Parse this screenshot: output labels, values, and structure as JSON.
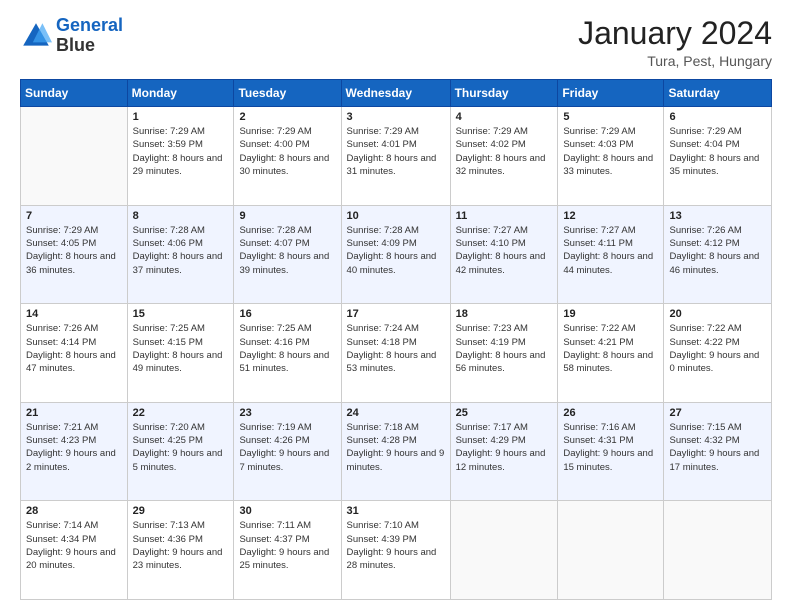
{
  "header": {
    "logo_line1": "General",
    "logo_line2": "Blue",
    "title": "January 2024",
    "subtitle": "Tura, Pest, Hungary"
  },
  "weekdays": [
    "Sunday",
    "Monday",
    "Tuesday",
    "Wednesday",
    "Thursday",
    "Friday",
    "Saturday"
  ],
  "weeks": [
    [
      {
        "day": "",
        "sunrise": "",
        "sunset": "",
        "daylight": ""
      },
      {
        "day": "1",
        "sunrise": "7:29 AM",
        "sunset": "3:59 PM",
        "daylight": "8 hours and 29 minutes."
      },
      {
        "day": "2",
        "sunrise": "7:29 AM",
        "sunset": "4:00 PM",
        "daylight": "8 hours and 30 minutes."
      },
      {
        "day": "3",
        "sunrise": "7:29 AM",
        "sunset": "4:01 PM",
        "daylight": "8 hours and 31 minutes."
      },
      {
        "day": "4",
        "sunrise": "7:29 AM",
        "sunset": "4:02 PM",
        "daylight": "8 hours and 32 minutes."
      },
      {
        "day": "5",
        "sunrise": "7:29 AM",
        "sunset": "4:03 PM",
        "daylight": "8 hours and 33 minutes."
      },
      {
        "day": "6",
        "sunrise": "7:29 AM",
        "sunset": "4:04 PM",
        "daylight": "8 hours and 35 minutes."
      }
    ],
    [
      {
        "day": "7",
        "sunrise": "7:29 AM",
        "sunset": "4:05 PM",
        "daylight": "8 hours and 36 minutes."
      },
      {
        "day": "8",
        "sunrise": "7:28 AM",
        "sunset": "4:06 PM",
        "daylight": "8 hours and 37 minutes."
      },
      {
        "day": "9",
        "sunrise": "7:28 AM",
        "sunset": "4:07 PM",
        "daylight": "8 hours and 39 minutes."
      },
      {
        "day": "10",
        "sunrise": "7:28 AM",
        "sunset": "4:09 PM",
        "daylight": "8 hours and 40 minutes."
      },
      {
        "day": "11",
        "sunrise": "7:27 AM",
        "sunset": "4:10 PM",
        "daylight": "8 hours and 42 minutes."
      },
      {
        "day": "12",
        "sunrise": "7:27 AM",
        "sunset": "4:11 PM",
        "daylight": "8 hours and 44 minutes."
      },
      {
        "day": "13",
        "sunrise": "7:26 AM",
        "sunset": "4:12 PM",
        "daylight": "8 hours and 46 minutes."
      }
    ],
    [
      {
        "day": "14",
        "sunrise": "7:26 AM",
        "sunset": "4:14 PM",
        "daylight": "8 hours and 47 minutes."
      },
      {
        "day": "15",
        "sunrise": "7:25 AM",
        "sunset": "4:15 PM",
        "daylight": "8 hours and 49 minutes."
      },
      {
        "day": "16",
        "sunrise": "7:25 AM",
        "sunset": "4:16 PM",
        "daylight": "8 hours and 51 minutes."
      },
      {
        "day": "17",
        "sunrise": "7:24 AM",
        "sunset": "4:18 PM",
        "daylight": "8 hours and 53 minutes."
      },
      {
        "day": "18",
        "sunrise": "7:23 AM",
        "sunset": "4:19 PM",
        "daylight": "8 hours and 56 minutes."
      },
      {
        "day": "19",
        "sunrise": "7:22 AM",
        "sunset": "4:21 PM",
        "daylight": "8 hours and 58 minutes."
      },
      {
        "day": "20",
        "sunrise": "7:22 AM",
        "sunset": "4:22 PM",
        "daylight": "9 hours and 0 minutes."
      }
    ],
    [
      {
        "day": "21",
        "sunrise": "7:21 AM",
        "sunset": "4:23 PM",
        "daylight": "9 hours and 2 minutes."
      },
      {
        "day": "22",
        "sunrise": "7:20 AM",
        "sunset": "4:25 PM",
        "daylight": "9 hours and 5 minutes."
      },
      {
        "day": "23",
        "sunrise": "7:19 AM",
        "sunset": "4:26 PM",
        "daylight": "9 hours and 7 minutes."
      },
      {
        "day": "24",
        "sunrise": "7:18 AM",
        "sunset": "4:28 PM",
        "daylight": "9 hours and 9 minutes."
      },
      {
        "day": "25",
        "sunrise": "7:17 AM",
        "sunset": "4:29 PM",
        "daylight": "9 hours and 12 minutes."
      },
      {
        "day": "26",
        "sunrise": "7:16 AM",
        "sunset": "4:31 PM",
        "daylight": "9 hours and 15 minutes."
      },
      {
        "day": "27",
        "sunrise": "7:15 AM",
        "sunset": "4:32 PM",
        "daylight": "9 hours and 17 minutes."
      }
    ],
    [
      {
        "day": "28",
        "sunrise": "7:14 AM",
        "sunset": "4:34 PM",
        "daylight": "9 hours and 20 minutes."
      },
      {
        "day": "29",
        "sunrise": "7:13 AM",
        "sunset": "4:36 PM",
        "daylight": "9 hours and 23 minutes."
      },
      {
        "day": "30",
        "sunrise": "7:11 AM",
        "sunset": "4:37 PM",
        "daylight": "9 hours and 25 minutes."
      },
      {
        "day": "31",
        "sunrise": "7:10 AM",
        "sunset": "4:39 PM",
        "daylight": "9 hours and 28 minutes."
      },
      {
        "day": "",
        "sunrise": "",
        "sunset": "",
        "daylight": ""
      },
      {
        "day": "",
        "sunrise": "",
        "sunset": "",
        "daylight": ""
      },
      {
        "day": "",
        "sunrise": "",
        "sunset": "",
        "daylight": ""
      }
    ]
  ]
}
